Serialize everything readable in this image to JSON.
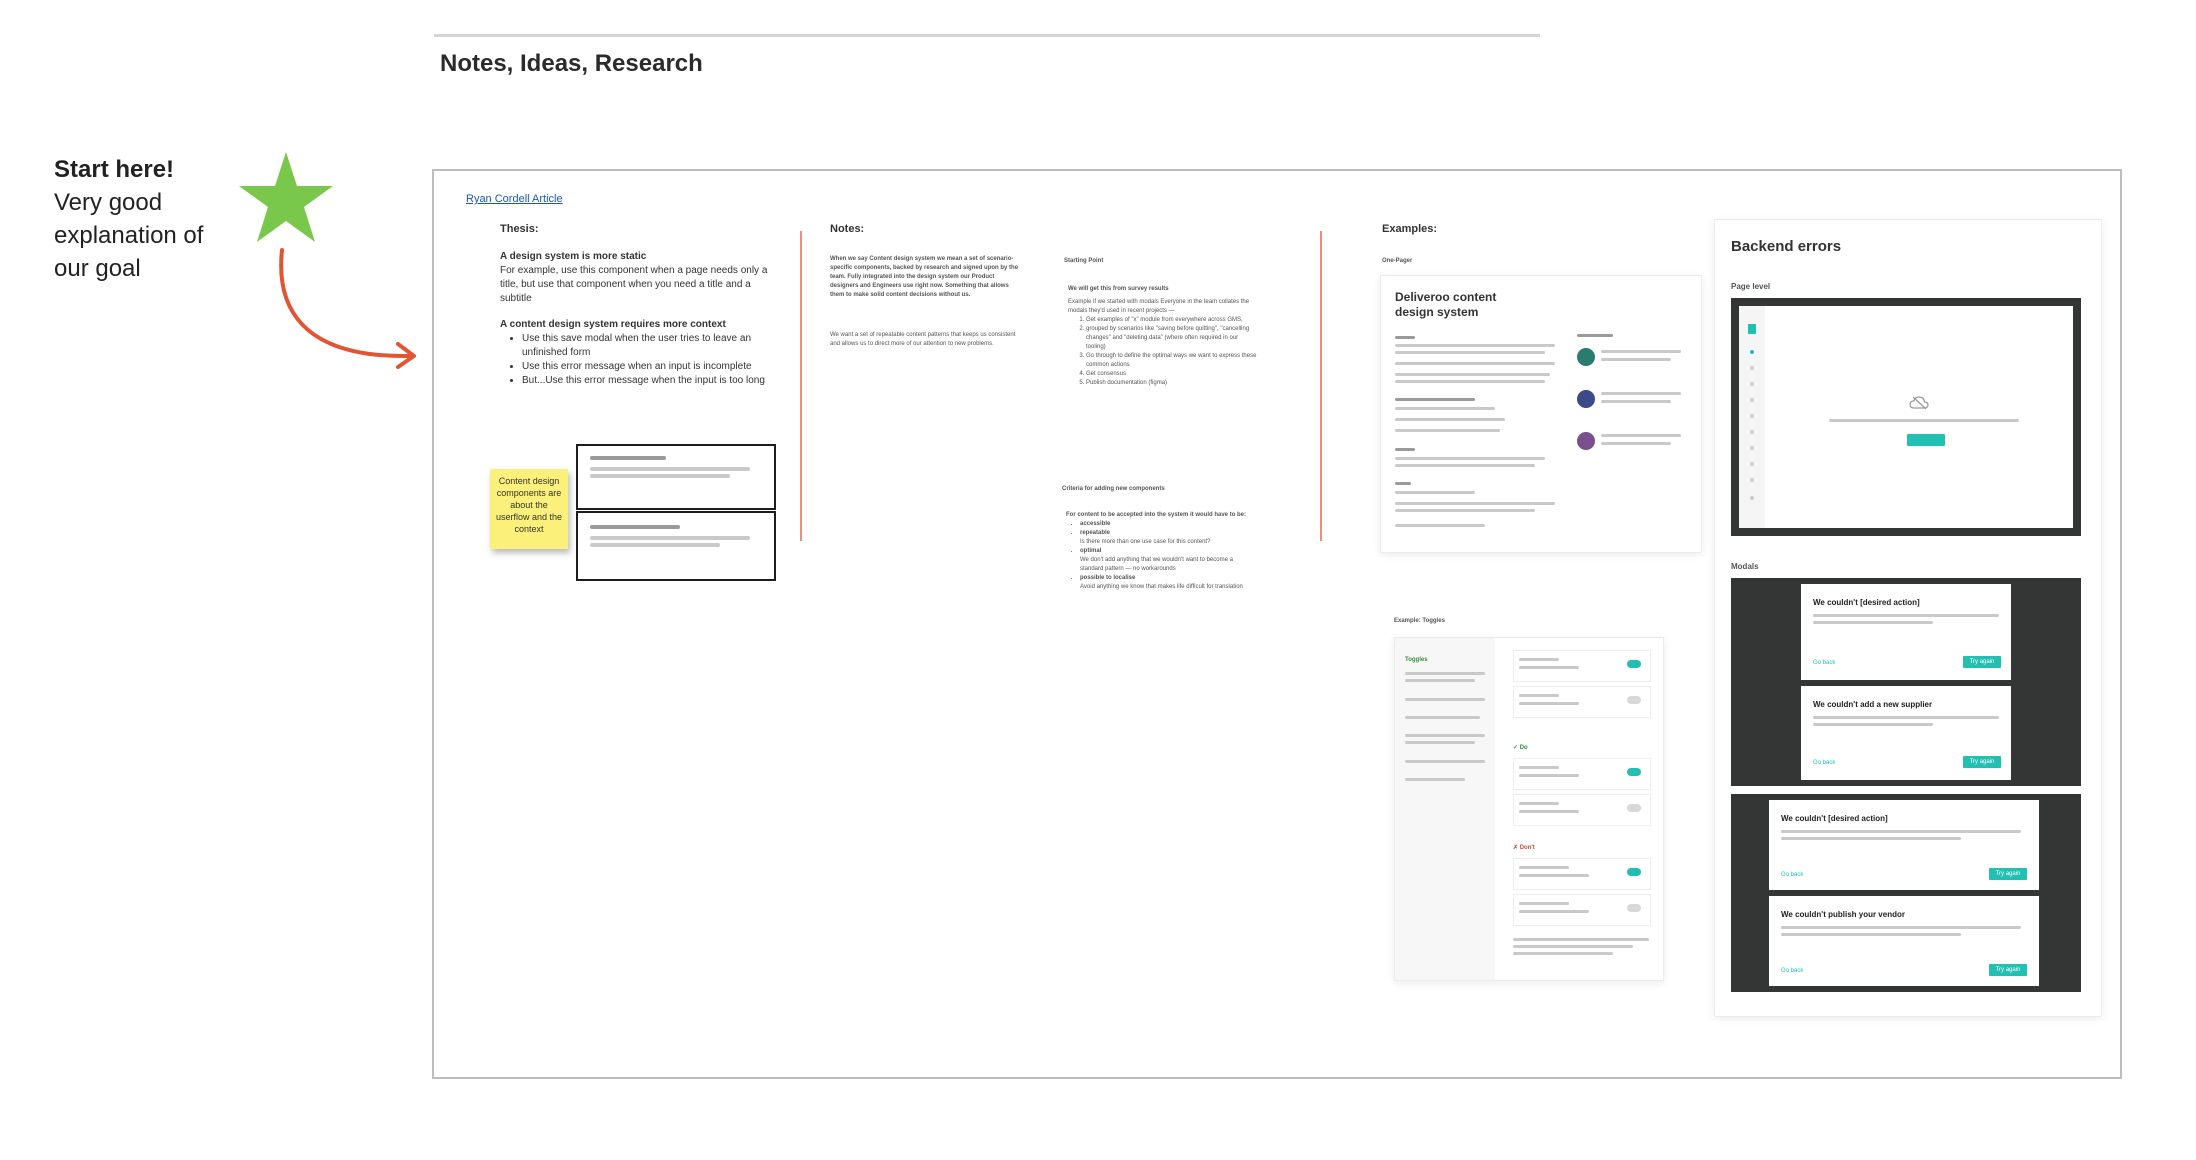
{
  "header": {
    "section_title": "Notes, Ideas, Research"
  },
  "callout": {
    "title": "Start here!",
    "line1": "Very good",
    "line2": "explanation of",
    "line3": "our goal"
  },
  "colors": {
    "star": "#7ac84b",
    "arrow": "#e25534",
    "teal": "#22bfb3",
    "divider": "#e98f7e",
    "sticky": "#fbf17a",
    "dark_panel": "#333634"
  },
  "board": {
    "link": "Ryan Cordell Article",
    "thesis": {
      "heading": "Thesis:",
      "static_title": "A design system is more static",
      "static_body": "For example, use this component when a page needs only a title, but use that component when you need a title and a subtitle",
      "context_title": "A content design system requires more context",
      "bullets": [
        "Use this save modal when the user tries to leave an unfinished form",
        "Use this error message when an input is incomplete",
        "But...Use this error message when the input is too long"
      ],
      "sticky": "Content design components are about the userflow and the context"
    },
    "notes": {
      "heading": "Notes:",
      "intro": "When we say Content design system we mean a set of scenario-specific components, backed by research and signed upon by the team. Fully integrated into the design system our Product designers and Engineers use right now. Something that allows them to make solid content decisions without us.",
      "goal": "We want a set of repeatable content patterns that keeps us consistent and allows us to direct more of our attention to new problems.",
      "starting_point": "Starting Point",
      "survey": "We will get this from survey results",
      "example_intro": "Example if we started with modals Everyone in the team collates the modals they'd used in recent projects —",
      "steps": [
        "Get examples of \"x\" module from everywhere across GMS,",
        "grouped by scenarios like \"saving before quitting\", \"cancelling changes\" and \"deleting data\" (where often required in our tooling)",
        "Go through to define the optimal ways we want to express these common actions",
        "Get consensus",
        "Publish documentation (figma)"
      ],
      "criteria_title": "Criteria for adding new components",
      "criteria_intro": "For content to be accepted into the system it would have to be:",
      "criteria": [
        {
          "name": "accessible",
          "detail": ""
        },
        {
          "name": "repeatable",
          "detail": "Is there more than one use case for this content?"
        },
        {
          "name": "optimal",
          "detail": "We don't add anything that we wouldn't want to become a standard pattern — no workarounds"
        },
        {
          "name": "possible to localise",
          "detail": "Avoid anything we know that makes life difficult for translation"
        }
      ]
    },
    "examples": {
      "heading": "Examples:",
      "one_pager_label": "One-Pager",
      "deliveroo_title": "Deliveroo content design system",
      "toggles_label": "Example: Toggles",
      "do_label": "Do",
      "dont_label": "Don't",
      "toggle_item_label": "Toggles"
    },
    "backend": {
      "title": "Backend errors",
      "page_level": "Page level",
      "modals": "Modals",
      "modal_titles": [
        "We couldn't [desired action]",
        "We couldn't add a new supplier",
        "We couldn't [desired action]",
        "We couldn't publish your vendor"
      ],
      "button_label": "Try again",
      "secondary_label": "Go back"
    }
  }
}
